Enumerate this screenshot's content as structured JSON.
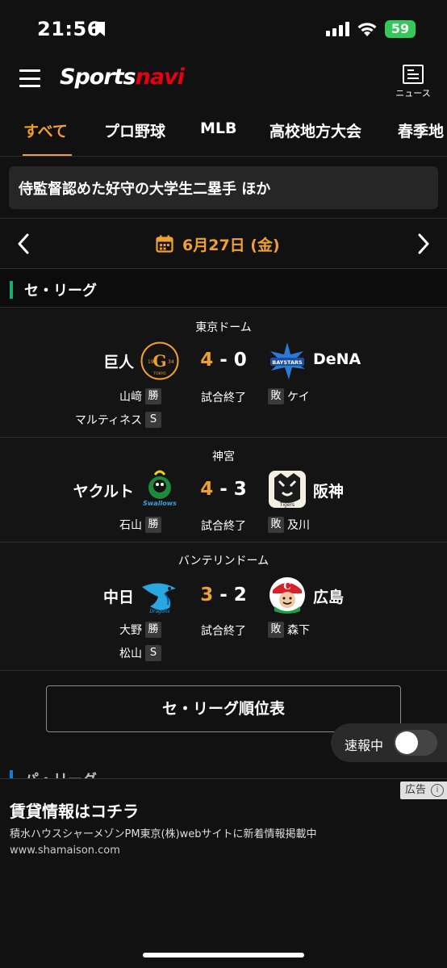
{
  "status_bar": {
    "time": "21:56",
    "battery": "59"
  },
  "header": {
    "logo_part1": "Sports",
    "logo_part2": "navi",
    "news_label": "ニュース"
  },
  "tabs": [
    {
      "label": "すべて"
    },
    {
      "label": "プロ野球"
    },
    {
      "label": "MLB"
    },
    {
      "label": "高校地方大会"
    },
    {
      "label": "春季地"
    }
  ],
  "headline": "侍監督認めた好守の大学生二塁手 ほか",
  "date_nav": {
    "date": "6月27日 (金)"
  },
  "league": {
    "title": "セ・リーグ"
  },
  "games": [
    {
      "venue": "東京ドーム",
      "home": "巨人",
      "away": "DeNA",
      "home_score": "4",
      "away_score": "0",
      "sep": "-",
      "status": "試合終了",
      "win_pitcher": "山﨑",
      "win_tag": "勝",
      "save_pitcher": "マルティネス",
      "save_tag": "S",
      "lose_pitcher": "ケイ",
      "lose_tag": "敗",
      "home_logo_text": "G",
      "home_logo_year_l": "19",
      "home_logo_year_r": "34",
      "home_logo_city": "TOKYO",
      "away_logo_text": "BAYSTARS"
    },
    {
      "venue": "神宮",
      "home": "ヤクルト",
      "away": "阪神",
      "home_score": "4",
      "away_score": "3",
      "sep": "-",
      "status": "試合終了",
      "win_pitcher": "石山",
      "win_tag": "勝",
      "lose_pitcher": "及川",
      "lose_tag": "敗",
      "home_logo_text": "Swallows",
      "away_logo_text": "Tigers"
    },
    {
      "venue": "バンテリンドーム",
      "home": "中日",
      "away": "広島",
      "home_score": "3",
      "away_score": "2",
      "sep": "-",
      "status": "試合終了",
      "win_pitcher": "大野",
      "win_tag": "勝",
      "save_pitcher": "松山",
      "save_tag": "S",
      "lose_pitcher": "森下",
      "lose_tag": "敗",
      "home_logo_text": "Dragons",
      "away_logo_text": "C"
    }
  ],
  "standings_button": "セ・リーグ順位表",
  "live_toggle": {
    "label": "速報中",
    "on": false
  },
  "league2": {
    "title": "パ・リーグ"
  },
  "ad": {
    "badge": "広告",
    "headline": "賃貸情報はコチラ",
    "description": "積水ハウスシャーメゾンPM東京(株)webサイトに新着情報掲載中",
    "url": "www.shamaison.com"
  },
  "colors": {
    "accent": "#f0a030",
    "league_bar": "#1aaa6a",
    "brand_red": "#e60012"
  }
}
